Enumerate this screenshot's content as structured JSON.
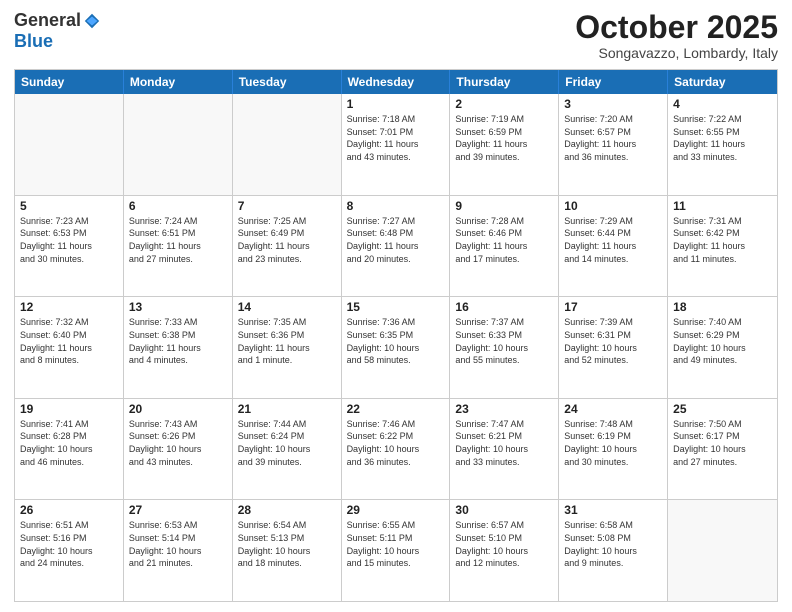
{
  "header": {
    "logo_general": "General",
    "logo_blue": "Blue",
    "month_title": "October 2025",
    "location": "Songavazzo, Lombardy, Italy"
  },
  "days_of_week": [
    "Sunday",
    "Monday",
    "Tuesday",
    "Wednesday",
    "Thursday",
    "Friday",
    "Saturday"
  ],
  "weeks": [
    [
      {
        "day": "",
        "info": ""
      },
      {
        "day": "",
        "info": ""
      },
      {
        "day": "",
        "info": ""
      },
      {
        "day": "1",
        "info": "Sunrise: 7:18 AM\nSunset: 7:01 PM\nDaylight: 11 hours\nand 43 minutes."
      },
      {
        "day": "2",
        "info": "Sunrise: 7:19 AM\nSunset: 6:59 PM\nDaylight: 11 hours\nand 39 minutes."
      },
      {
        "day": "3",
        "info": "Sunrise: 7:20 AM\nSunset: 6:57 PM\nDaylight: 11 hours\nand 36 minutes."
      },
      {
        "day": "4",
        "info": "Sunrise: 7:22 AM\nSunset: 6:55 PM\nDaylight: 11 hours\nand 33 minutes."
      }
    ],
    [
      {
        "day": "5",
        "info": "Sunrise: 7:23 AM\nSunset: 6:53 PM\nDaylight: 11 hours\nand 30 minutes."
      },
      {
        "day": "6",
        "info": "Sunrise: 7:24 AM\nSunset: 6:51 PM\nDaylight: 11 hours\nand 27 minutes."
      },
      {
        "day": "7",
        "info": "Sunrise: 7:25 AM\nSunset: 6:49 PM\nDaylight: 11 hours\nand 23 minutes."
      },
      {
        "day": "8",
        "info": "Sunrise: 7:27 AM\nSunset: 6:48 PM\nDaylight: 11 hours\nand 20 minutes."
      },
      {
        "day": "9",
        "info": "Sunrise: 7:28 AM\nSunset: 6:46 PM\nDaylight: 11 hours\nand 17 minutes."
      },
      {
        "day": "10",
        "info": "Sunrise: 7:29 AM\nSunset: 6:44 PM\nDaylight: 11 hours\nand 14 minutes."
      },
      {
        "day": "11",
        "info": "Sunrise: 7:31 AM\nSunset: 6:42 PM\nDaylight: 11 hours\nand 11 minutes."
      }
    ],
    [
      {
        "day": "12",
        "info": "Sunrise: 7:32 AM\nSunset: 6:40 PM\nDaylight: 11 hours\nand 8 minutes."
      },
      {
        "day": "13",
        "info": "Sunrise: 7:33 AM\nSunset: 6:38 PM\nDaylight: 11 hours\nand 4 minutes."
      },
      {
        "day": "14",
        "info": "Sunrise: 7:35 AM\nSunset: 6:36 PM\nDaylight: 11 hours\nand 1 minute."
      },
      {
        "day": "15",
        "info": "Sunrise: 7:36 AM\nSunset: 6:35 PM\nDaylight: 10 hours\nand 58 minutes."
      },
      {
        "day": "16",
        "info": "Sunrise: 7:37 AM\nSunset: 6:33 PM\nDaylight: 10 hours\nand 55 minutes."
      },
      {
        "day": "17",
        "info": "Sunrise: 7:39 AM\nSunset: 6:31 PM\nDaylight: 10 hours\nand 52 minutes."
      },
      {
        "day": "18",
        "info": "Sunrise: 7:40 AM\nSunset: 6:29 PM\nDaylight: 10 hours\nand 49 minutes."
      }
    ],
    [
      {
        "day": "19",
        "info": "Sunrise: 7:41 AM\nSunset: 6:28 PM\nDaylight: 10 hours\nand 46 minutes."
      },
      {
        "day": "20",
        "info": "Sunrise: 7:43 AM\nSunset: 6:26 PM\nDaylight: 10 hours\nand 43 minutes."
      },
      {
        "day": "21",
        "info": "Sunrise: 7:44 AM\nSunset: 6:24 PM\nDaylight: 10 hours\nand 39 minutes."
      },
      {
        "day": "22",
        "info": "Sunrise: 7:46 AM\nSunset: 6:22 PM\nDaylight: 10 hours\nand 36 minutes."
      },
      {
        "day": "23",
        "info": "Sunrise: 7:47 AM\nSunset: 6:21 PM\nDaylight: 10 hours\nand 33 minutes."
      },
      {
        "day": "24",
        "info": "Sunrise: 7:48 AM\nSunset: 6:19 PM\nDaylight: 10 hours\nand 30 minutes."
      },
      {
        "day": "25",
        "info": "Sunrise: 7:50 AM\nSunset: 6:17 PM\nDaylight: 10 hours\nand 27 minutes."
      }
    ],
    [
      {
        "day": "26",
        "info": "Sunrise: 6:51 AM\nSunset: 5:16 PM\nDaylight: 10 hours\nand 24 minutes."
      },
      {
        "day": "27",
        "info": "Sunrise: 6:53 AM\nSunset: 5:14 PM\nDaylight: 10 hours\nand 21 minutes."
      },
      {
        "day": "28",
        "info": "Sunrise: 6:54 AM\nSunset: 5:13 PM\nDaylight: 10 hours\nand 18 minutes."
      },
      {
        "day": "29",
        "info": "Sunrise: 6:55 AM\nSunset: 5:11 PM\nDaylight: 10 hours\nand 15 minutes."
      },
      {
        "day": "30",
        "info": "Sunrise: 6:57 AM\nSunset: 5:10 PM\nDaylight: 10 hours\nand 12 minutes."
      },
      {
        "day": "31",
        "info": "Sunrise: 6:58 AM\nSunset: 5:08 PM\nDaylight: 10 hours\nand 9 minutes."
      },
      {
        "day": "",
        "info": ""
      }
    ]
  ]
}
